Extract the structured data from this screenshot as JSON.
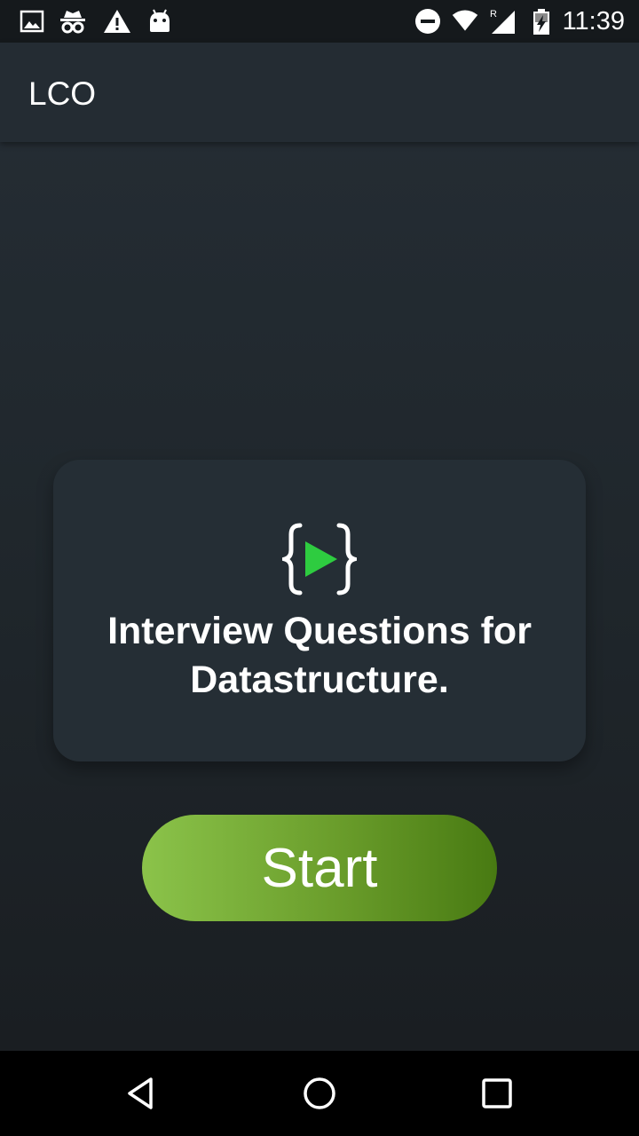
{
  "status_bar": {
    "time": "11:39",
    "icons": [
      "image-icon",
      "incognito-icon",
      "warning-icon",
      "android-icon",
      "do-not-disturb-icon",
      "wifi-icon",
      "cell-signal-roaming-icon",
      "battery-charging-icon"
    ],
    "roaming_label": "R"
  },
  "app_bar": {
    "title": "LCO"
  },
  "card": {
    "logo_icon": "code-braces-play-icon",
    "title": "Interview Questions for Datastructure."
  },
  "start_button": {
    "label": "Start"
  },
  "nav_bar": {
    "icons": [
      "back-icon",
      "home-icon",
      "recents-icon"
    ]
  },
  "colors": {
    "accent_green": "#2ecc40",
    "button_gradient_start": "#8bc34a",
    "button_gradient_end": "#487a12",
    "app_bar_bg": "#242c33",
    "card_bg": "#252e35"
  }
}
